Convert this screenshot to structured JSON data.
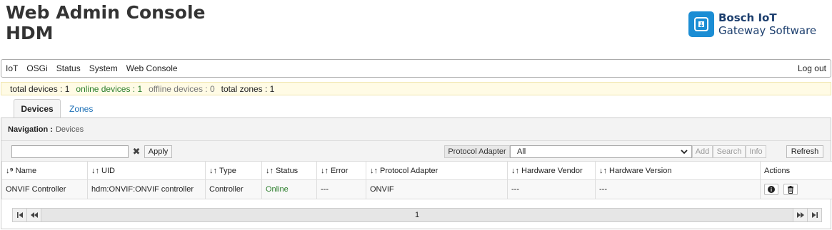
{
  "header": {
    "title_line1": "Web Admin Console",
    "title_line2": "HDM",
    "brand_name": "Bosch IoT",
    "brand_sub": "Gateway Software"
  },
  "menu": {
    "items": [
      "IoT",
      "OSGi",
      "Status",
      "System",
      "Web Console"
    ],
    "logout": "Log out"
  },
  "summary": {
    "total_devices": "total devices : 1",
    "online_devices": "online devices : 1",
    "offline_devices": "offline devices : 0",
    "total_zones": "total zones : 1"
  },
  "tabs": {
    "devices": "Devices",
    "zones": "Zones"
  },
  "navigation": {
    "label": "Navigation :",
    "value": "Devices"
  },
  "toolbar": {
    "filter_value": "",
    "apply": "Apply",
    "protocol_adapter_label": "Protocol Adapter",
    "protocol_adapter_value": "All",
    "add": "Add",
    "search": "Search",
    "info": "Info",
    "refresh": "Refresh"
  },
  "table": {
    "columns": [
      "Name",
      "UID",
      "Type",
      "Status",
      "Error",
      "Protocol Adapter",
      "Hardware Vendor",
      "Hardware Version",
      "Actions"
    ],
    "rows": [
      {
        "name": "ONVIF Controller",
        "uid": "hdm:ONVIF:ONVIF controller",
        "type": "Controller",
        "status": "Online",
        "error": "---",
        "protocol_adapter": "ONVIF",
        "hardware_vendor": "---",
        "hardware_version": "---"
      }
    ]
  },
  "pager": {
    "page": "1"
  },
  "colors": {
    "brand_blue": "#1b8dd4",
    "online_green": "#2a7d2a",
    "summary_bg": "#fffbe5"
  }
}
